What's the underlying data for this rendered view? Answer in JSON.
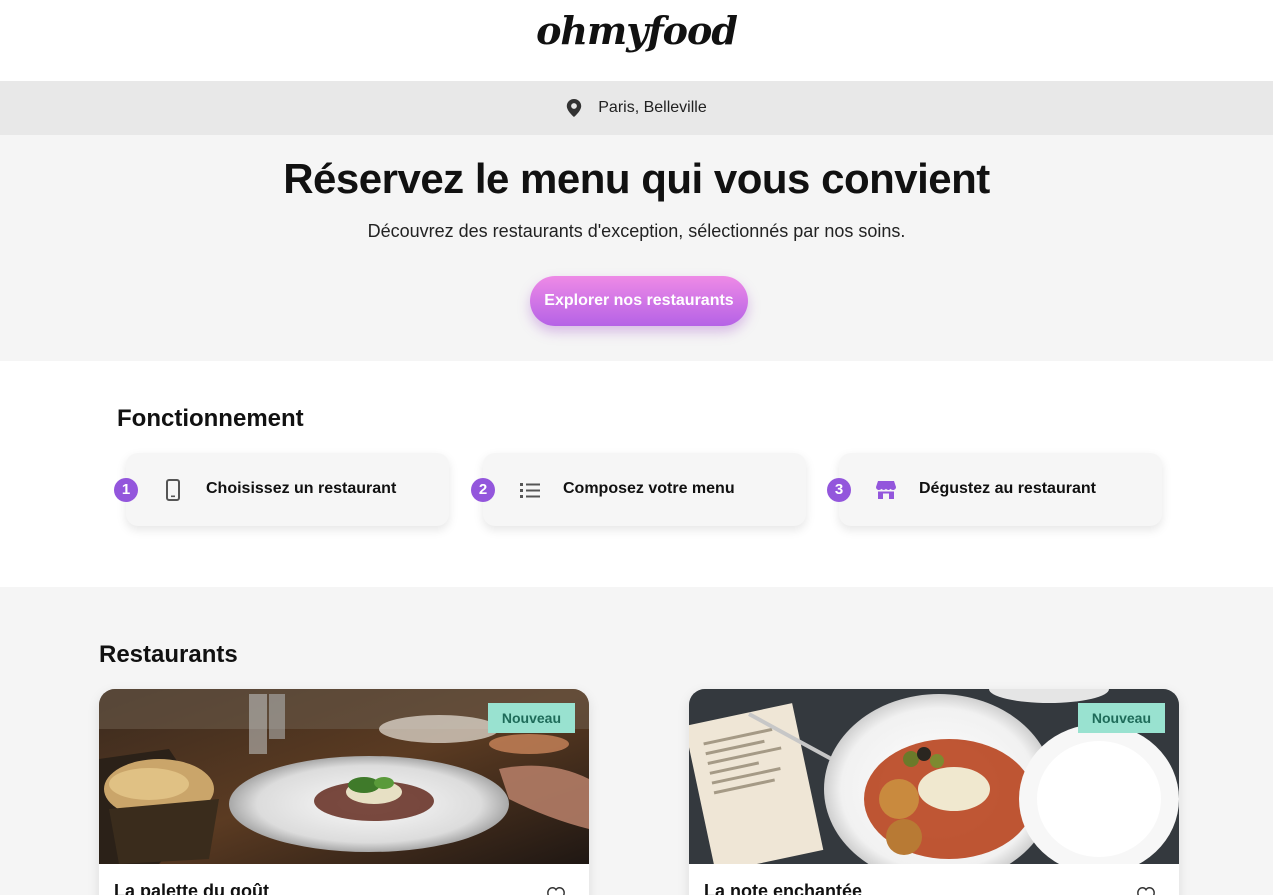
{
  "header": {
    "logo": "ohmyfood"
  },
  "location": {
    "icon": "map-pin-icon",
    "text": "Paris, Belleville"
  },
  "hero": {
    "title": "Réservez le menu qui vous convient",
    "subtitle": "Découvrez des restaurants d'exception, sélectionnés par nos soins.",
    "cta_label": "Explorer nos restaurants"
  },
  "how": {
    "title": "Fonctionnement",
    "steps": [
      {
        "num": "1",
        "icon": "mobile-phone-icon",
        "label": "Choisissez un restaurant"
      },
      {
        "num": "2",
        "icon": "list-icon",
        "label": "Composez votre menu"
      },
      {
        "num": "3",
        "icon": "store-icon",
        "label": "Dégustez au restaurant"
      }
    ]
  },
  "restaurants": {
    "title": "Restaurants",
    "cards": [
      {
        "name": "La palette du goût",
        "badge": "Nouveau",
        "icon": "heart-icon"
      },
      {
        "name": "La note enchantée",
        "badge": "Nouveau",
        "icon": "heart-icon"
      }
    ]
  },
  "colors": {
    "accent_purple": "#9356dc",
    "cta_gradient_top": "#ee8ae6",
    "cta_gradient_bottom": "#b562e6",
    "badge_bg": "#99e2d0",
    "badge_text": "#1e6b59"
  }
}
